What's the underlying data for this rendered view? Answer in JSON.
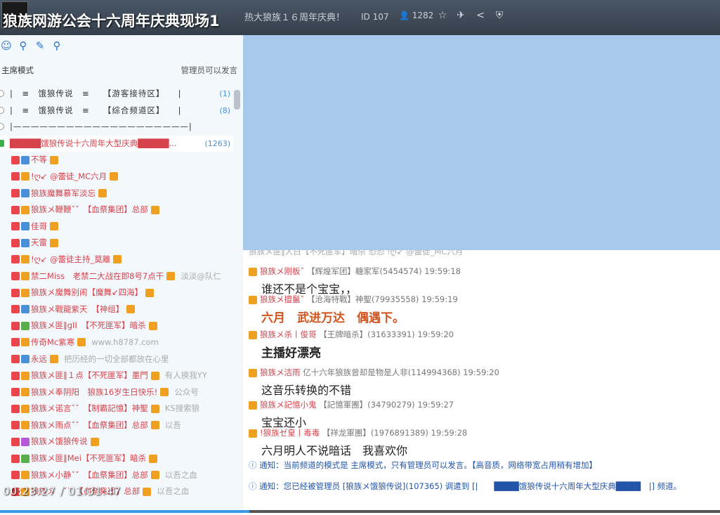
{
  "window": {
    "title": "狼族网游公会十六周年庆典现场1",
    "channel_banner": "热大狼族１６周年庆典！",
    "id_label": "ID 107",
    "user_count": "1282"
  },
  "toolbar": {
    "icons": [
      "user-icon",
      "location-icon",
      "edit-icon",
      "search-icon"
    ]
  },
  "mode": {
    "label": "主席模式",
    "note": "管理员可以发言"
  },
  "tree": {
    "channels": [
      {
        "name": "|　≡　饿狼传说　≡　　【游客接待区】　　|",
        "count": "(1)"
      },
      {
        "name": "|　≡　饿狼传说　≡　　【综合频道区】　　|",
        "count": "(8)"
      },
      {
        "name": "|————————————————————|",
        "count": ""
      }
    ],
    "current": {
      "name": "█████饿狼传说十六周年大型庆典█████...",
      "count": "(1263)"
    },
    "users": [
      {
        "name": "不等",
        "extra": ""
      },
      {
        "name": "!ღ↙ @蕾徒_MC六月",
        "extra": ""
      },
      {
        "name": "狼族魔舞慕军淡忘",
        "extra": ""
      },
      {
        "name": "狼族メ鞭鞭ˇˇ　【血祭集团】总部",
        "extra": ""
      },
      {
        "name": "佳哥",
        "extra": ""
      },
      {
        "name": "天雷",
        "extra": ""
      },
      {
        "name": "!ღ↙ @蕾徒主持_莫離",
        "extra": ""
      },
      {
        "name": "禁二Miss　老禁二大战在即8号7点干",
        "extra": "淡淡@队仁"
      },
      {
        "name": "狼族メ魔舞别闹【魔舞↙四海】",
        "extra": ""
      },
      {
        "name": "狼族メ戰龍紫天　【神组】",
        "extra": ""
      },
      {
        "name": "狼族メ匪‖gII　【不死匪军】暗杀",
        "extra": ""
      },
      {
        "name": "传奇Mc紫寒",
        "extra": "www.h8787.com"
      },
      {
        "name": "永远",
        "extra": "把历经的一切全部都放在心里"
      },
      {
        "name": "狼族メ匪‖１点【不死匪军】墨門",
        "extra": "有人换我YY"
      },
      {
        "name": "狼族メ奉阴阳　狼族16岁生日快乐!",
        "extra": "公众号"
      },
      {
        "name": "狼族メ诺言ˇˇ　【制霸記憶】神聖",
        "extra": "KS搜索狼"
      },
      {
        "name": "狼族メ雨点ˇˇ　【血祭集团】总部",
        "extra": "以吾"
      },
      {
        "name": "狼族メ饿狼传说",
        "extra": ""
      },
      {
        "name": "狼族メ匪‖Mei【不死匪军】暗杀",
        "extra": ""
      },
      {
        "name": "狼族メ小静ˇˇ　【血祭集团】总部",
        "extra": "以吾之血"
      },
      {
        "name": "狼族メ　ˇˇ　【血祭集团】总部",
        "extra": "以吾之血"
      }
    ]
  },
  "chat": {
    "messages": [
      {
        "header_name": "狼族メ刚板ˇ",
        "header_rest": "【辉煌军团】糖家军(5454574) 19:59:18",
        "body": "谁还不是个宝宝，，",
        "style": "normal"
      },
      {
        "header_name": "狼族メ擅鬣ˇ",
        "header_rest": "【沧海特戰】神聖(79935558) 19:59:19",
        "body": "六月　武进万达　偶遇下。",
        "style": "big"
      },
      {
        "header_name": "狼族メ杀丨俊哥",
        "header_rest": "【王牌暗杀】(31633391) 19:59:20",
        "body": "主播好漂亮",
        "style": "bold"
      },
      {
        "header_name": "狼族メ洁雨",
        "header_rest": "亿十六年狼族曾却是物是人非(114994368) 19:59:20",
        "body": "这音乐转换的不错",
        "style": "normal"
      },
      {
        "header_name": "狼族メ記憶小鬼",
        "header_rest": "【記憶軍團】(34790279) 19:59:27",
        "body": "宝宝还小",
        "style": "normal"
      },
      {
        "header_name": "!狼族ゼ皇丨毒毒",
        "header_rest": "【祥龙軍團】(1976891389) 19:59:28",
        "body": "六月明人不说暗话　我喜欢你",
        "style": "normal"
      }
    ],
    "notice1": "通知：当前频道的模式是 主席模式，只有管理员可以发言。【高音质，网络带宽占用稍有增加】",
    "notice2": "通知：您已经被管理员 [狼族メ饿狼传说](107365) 调遣到 [|　　████饿狼传说十六周年大型庆典████　|] 频道。",
    "scrolled_top": "狼族メ匪‖人白【不死匪军】暗杀 恐恐 !ღ↙ @蕾徒_MC六月"
  },
  "player": {
    "time": "00:23:27 / 01:31:47",
    "progress": 0.346
  },
  "colors": {
    "accent_blue": "#3a9ae8",
    "name_red": "#d6424a",
    "orange_text": "#d0541e"
  }
}
